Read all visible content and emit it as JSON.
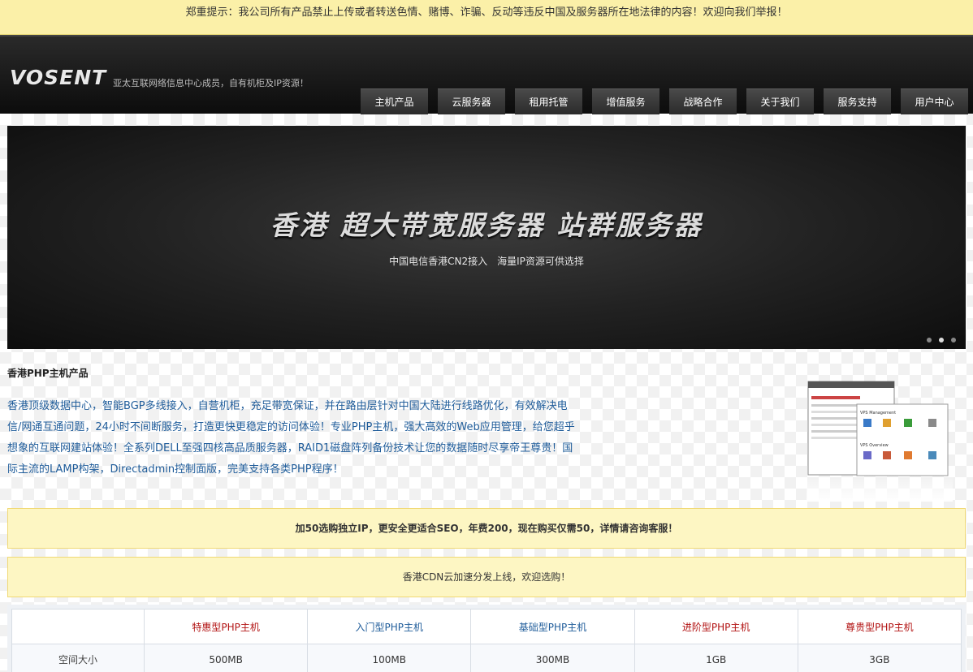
{
  "notice": "郑重提示：我公司所有产品禁止上传或者转送色情、赌博、诈骗、反动等违反中国及服务器所在地法律的内容！欢迎向我们举报！",
  "header": {
    "logo": "VOSENT",
    "tagline": "亚太互联网络信息中心成员，自有机柜及IP资源！"
  },
  "nav": [
    "主机产品",
    "云服务器",
    "租用托管",
    "增值服务",
    "战略合作",
    "关于我们",
    "服务支持",
    "用户中心"
  ],
  "banner": {
    "title": "香港 超大带宽服务器 站群服务器",
    "subtitle": "中国电信香港CN2接入　海量IP资源可供选择"
  },
  "section_title": "香港PHP主机产品",
  "intro": "香港顶级数据中心，智能BGP多线接入，自营机柜，充足带宽保证，并在路由层针对中国大陆进行线路优化，有效解决电信/网通互通问题，24小时不间断服务，打造更快更稳定的访问体验！专业PHP主机，强大高效的Web应用管理，给您超乎想象的互联网建站体验！全系列DELL至强四核高品质服务器，RAID1磁盘阵列备份技术让您的数据随时尽享帝王尊贵！国际主流的LAMP构架，Directadmin控制面版，完美支持各类PHP程序！",
  "callouts": [
    "加50选购独立IP，更安全更适合SEO，年费200，现在购买仅需50，详情请咨询客服！",
    "香港CDN云加速分发上线，欢迎选购！"
  ],
  "table": {
    "plans": [
      "特惠型PHP主机",
      "入门型PHP主机",
      "基础型PHP主机",
      "进阶型PHP主机",
      "尊贵型PHP主机"
    ],
    "rows": [
      {
        "label": "空间大小",
        "values": [
          "500MB",
          "100MB",
          "300MB",
          "1GB",
          "3GB"
        ]
      }
    ]
  },
  "colors": {
    "notice_bg": "#fbf0a8",
    "plan_red": "#b21313",
    "plan_blue": "#1f5c9a",
    "intro_text": "#1f5c9a"
  }
}
